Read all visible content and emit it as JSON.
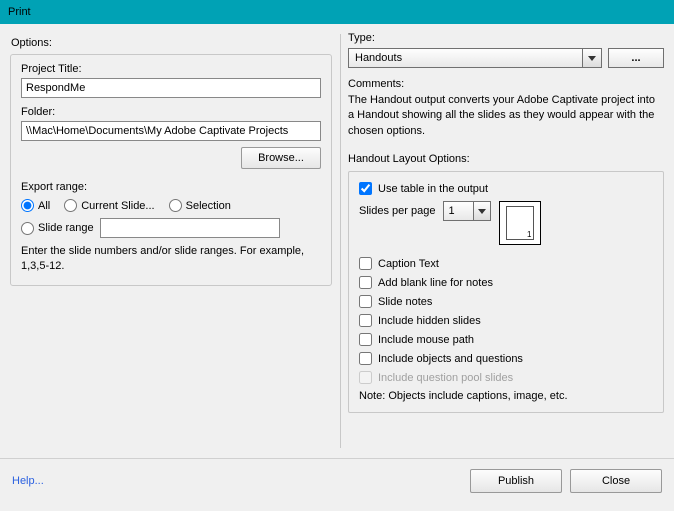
{
  "title": "Print",
  "left": {
    "section_label": "Options:",
    "project_title_label": "Project Title:",
    "project_title_value": "RespondMe",
    "folder_label": "Folder:",
    "folder_value": "\\\\Mac\\Home\\Documents\\My Adobe Captivate Projects",
    "browse_label": "Browse...",
    "export_range_label": "Export range:",
    "radio_all": "All",
    "radio_current": "Current Slide...",
    "radio_selection": "Selection",
    "radio_slide_range": "Slide range",
    "hint": "Enter the slide numbers and/or slide ranges. For example, 1,3,5-12."
  },
  "right": {
    "type_label": "Type:",
    "type_value": "Handouts",
    "ellipsis": "...",
    "comments_label": "Comments:",
    "comments_text": "The Handout output converts your Adobe Captivate project into a Handout showing all the slides as they would appear with the chosen options.",
    "layout_label": "Handout Layout Options:",
    "use_table": "Use table in the output",
    "slides_per_page_label": "Slides per page",
    "slides_per_page_value": "1",
    "check_caption": "Caption Text",
    "check_blank": "Add blank line for notes",
    "check_notes": "Slide notes",
    "check_hidden": "Include hidden slides",
    "check_mouse": "Include mouse path",
    "check_objects": "Include objects and questions",
    "check_pool": "Include question pool slides",
    "note": "Note: Objects include captions, image, etc."
  },
  "footer": {
    "help": "Help...",
    "publish": "Publish",
    "close": "Close"
  }
}
